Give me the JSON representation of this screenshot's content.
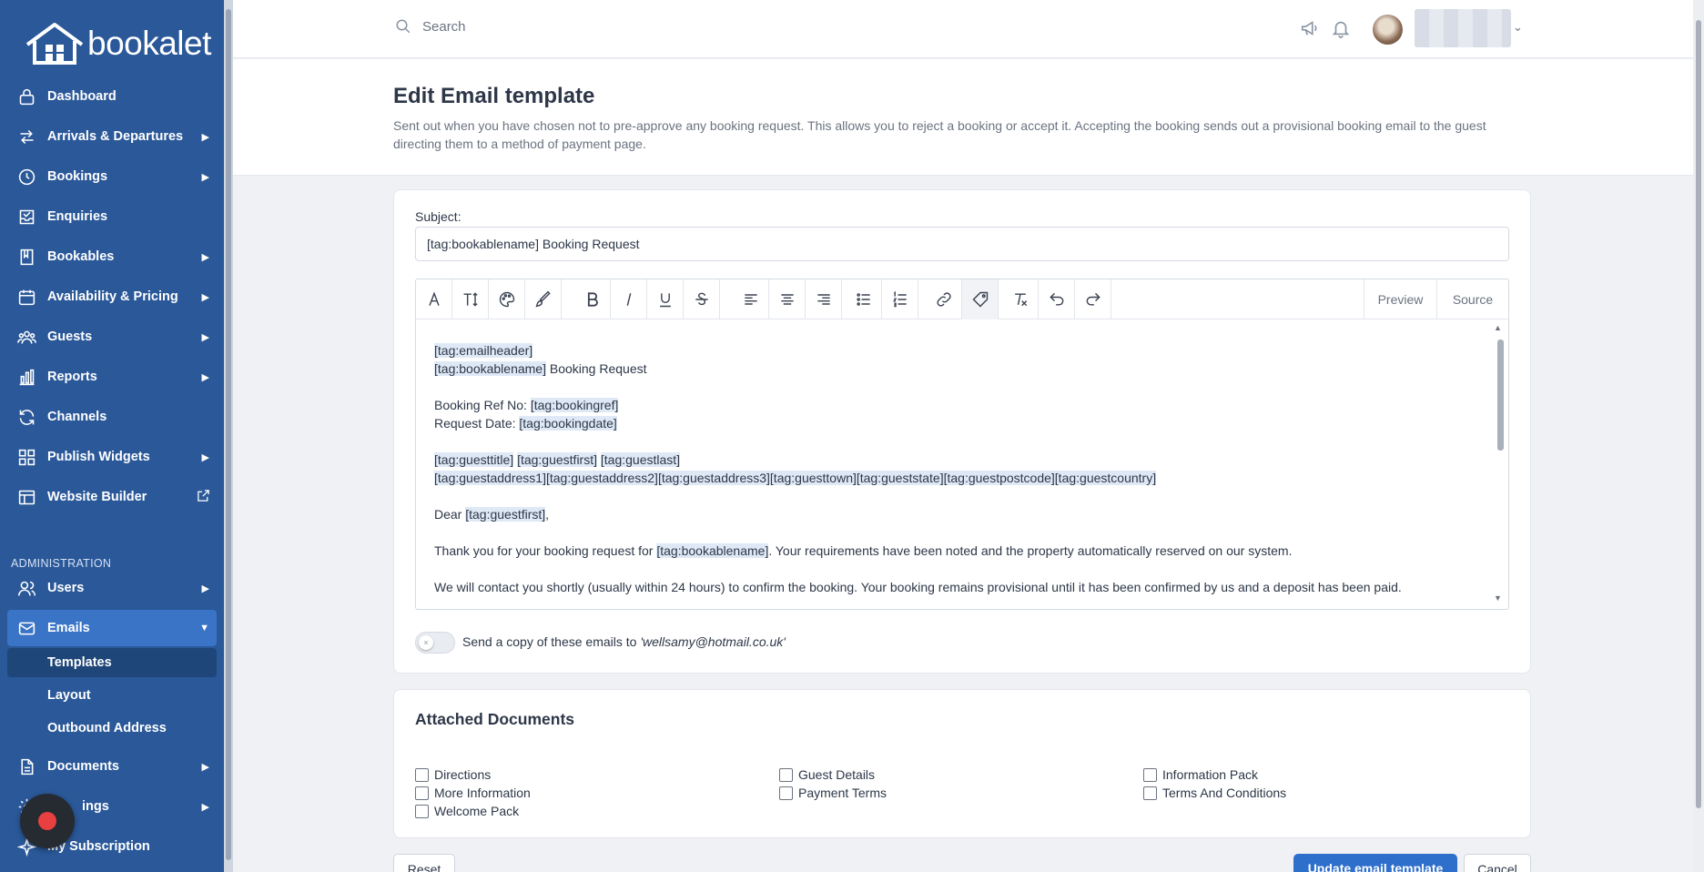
{
  "brand": {
    "name": "bookalet"
  },
  "sidebar": {
    "items": [
      {
        "label": "Dashboard",
        "icon": "lock-icon"
      },
      {
        "label": "Arrivals & Departures",
        "icon": "arrows-swap-icon"
      },
      {
        "label": "Bookings",
        "icon": "clock-icon"
      },
      {
        "label": "Enquiries",
        "icon": "inbox-check-icon"
      },
      {
        "label": "Bookables",
        "icon": "book-icon"
      },
      {
        "label": "Availability & Pricing",
        "icon": "calendar-icon"
      },
      {
        "label": "Guests",
        "icon": "users-icon"
      },
      {
        "label": "Reports",
        "icon": "bar-chart-icon"
      },
      {
        "label": "Channels",
        "icon": "refresh-icon"
      },
      {
        "label": "Publish Widgets",
        "icon": "grid-icon"
      },
      {
        "label": "Website Builder",
        "icon": "layout-icon"
      }
    ],
    "admin_label": "ADMINISTRATION",
    "admin_items": [
      {
        "label": "Users",
        "icon": "user-icon"
      },
      {
        "label": "Emails",
        "icon": "mail-icon"
      }
    ],
    "email_subitems": [
      "Templates",
      "Layout",
      "Outbound Address"
    ],
    "bottom_items": [
      {
        "label": "Documents",
        "icon": "document-icon"
      },
      {
        "label": "Settings",
        "icon": "gear-icon",
        "visible_label": "ings"
      },
      {
        "label": "My Subscription",
        "icon": "sparkle-icon",
        "visible_label": "My Subscription"
      }
    ]
  },
  "topbar": {
    "search_placeholder": "Search"
  },
  "page": {
    "title": "Edit Email template",
    "description": "Sent out when you have chosen not to pre-approve any booking request. This allows you to reject a booking or accept it. Accepting the booking sends out a provisional booking email to the guest directing them to a method of payment page."
  },
  "form": {
    "subject_label": "Subject:",
    "subject_value": "[tag:bookablename] Booking Request",
    "toolbar": {
      "preview_label": "Preview",
      "source_label": "Source"
    },
    "body_lines": {
      "l1_tag": "[tag:emailheader]",
      "l2_tag": "[tag:bookablename]",
      "l2_text": " Booking Request",
      "l3_text": "Booking Ref No: ",
      "l3_tag": "[tag:bookingref]",
      "l4_text": "Request Date: ",
      "l4_tag": "[tag:bookingdate]",
      "l5_tag1": "[tag:guesttitle]",
      "l5_tag2": "[tag:guestfirst]",
      "l5_tag3": "[tag:guestlast]",
      "l6_tag": "[tag:guestaddress1][tag:guestaddress2][tag:guestaddress3][tag:guesttown][tag:gueststate][tag:guestpostcode][tag:guestcountry]",
      "l7_text": "Dear ",
      "l7_tag": "[tag:guestfirst]",
      "l7_end": ",",
      "l8_text": "Thank you for your booking request for ",
      "l8_tag": "[tag:bookablename]",
      "l8_end": ". Your requirements have been noted and the property automatically reserved on our system.",
      "l9_text": "We will contact you shortly (usually within 24 hours) to confirm the booking. Your booking remains provisional until it has been confirmed by us and a deposit has been paid."
    },
    "copy_text": "Send a copy of these emails to",
    "copy_email": "'wellsamy@hotmail.co.uk'",
    "copy_enabled": false
  },
  "attachments": {
    "title": "Attached Documents",
    "items": [
      "Directions",
      "More Information",
      "Welcome Pack",
      "Guest Details",
      "Payment Terms",
      "Information Pack",
      "Terms And Conditions"
    ]
  },
  "buttons": {
    "reset": "Reset",
    "update": "Update email template",
    "cancel": "Cancel"
  },
  "colors": {
    "sidebar_bg": "#2a5899",
    "active_item": "#3a74c6",
    "primary_button": "#2f6fcc",
    "tag_highlight": "#dfe9f6"
  }
}
